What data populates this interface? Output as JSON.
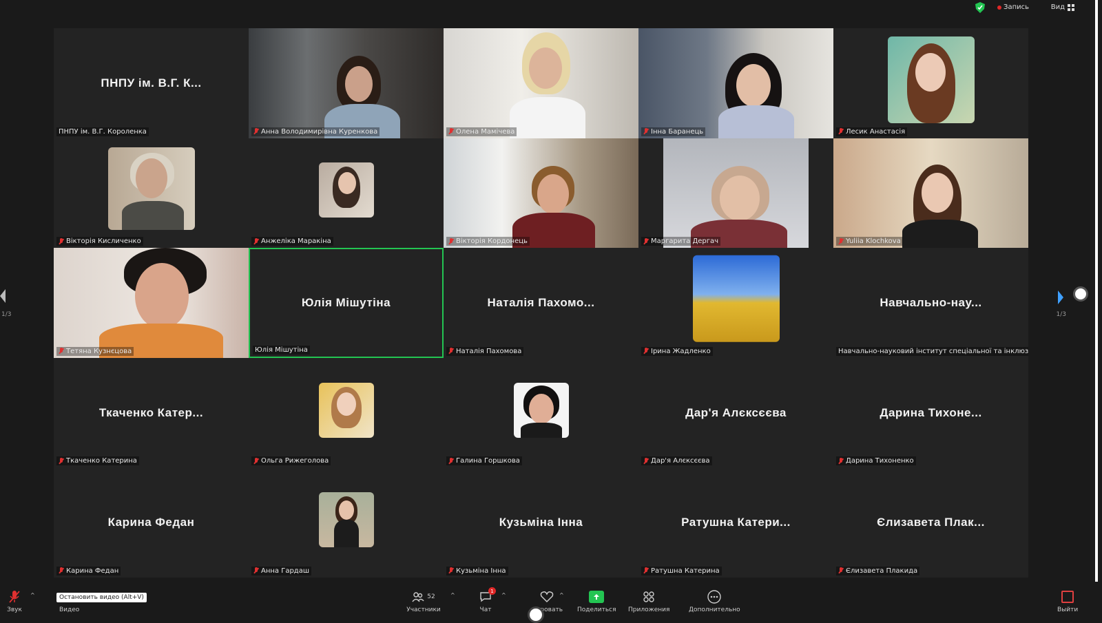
{
  "top": {
    "recording_label": "Запись",
    "view_label": "Вид"
  },
  "tiles": [
    {
      "big": "ПНПУ ім. В.Г. К...",
      "label": "ПНПУ ім. В.Г. Короленка",
      "muted": false
    },
    {
      "big": "",
      "label": "Анна Володимирівна Куренкова",
      "muted": true
    },
    {
      "big": "",
      "label": "Олена Мамічева",
      "muted": true
    },
    {
      "big": "",
      "label": "Інна Баранець",
      "muted": true
    },
    {
      "big": "",
      "label": "Лесик Анастасія",
      "muted": true
    },
    {
      "big": "",
      "label": "Вікторія Кисличенко",
      "muted": true
    },
    {
      "big": "",
      "label": "Анжеліка Маракіна",
      "muted": true
    },
    {
      "big": "",
      "label": "Вікторія Кордонець",
      "muted": true
    },
    {
      "big": "",
      "label": "Маргарита Дергач",
      "muted": true
    },
    {
      "big": "",
      "label": "Yuliia Klochkova",
      "muted": true
    },
    {
      "big": "",
      "label": "Тетяна Кузнєцова",
      "muted": true
    },
    {
      "big": "Юлія Мішутіна",
      "label": "Юлія Мішутіна",
      "muted": false
    },
    {
      "big": "Наталія Пахомо...",
      "label": "Наталія Пахомова",
      "muted": true
    },
    {
      "big": "",
      "label": "Ірина Жадленко",
      "muted": true
    },
    {
      "big": "Навчально-нау...",
      "label": "Навчально-науковий інститут спеціальної та інклюзи...",
      "muted": false
    },
    {
      "big": "Ткаченко Катер...",
      "label": "Ткаченко Катерина",
      "muted": true
    },
    {
      "big": "",
      "label": "Ольга Рижеголова",
      "muted": true
    },
    {
      "big": "",
      "label": "Галина Горшкова",
      "muted": true
    },
    {
      "big": "Дар'я Алєксєєва",
      "label": "Дар'я Алєксєєва",
      "muted": true
    },
    {
      "big": "Дарина Тихоне...",
      "label": "Дарина Тихоненко",
      "muted": true
    },
    {
      "big": "Карина Федан",
      "label": "Карина Федан",
      "muted": true
    },
    {
      "big": "",
      "label": "Анна Гардаш",
      "muted": true
    },
    {
      "big": "Кузьміна Інна",
      "label": "Кузьміна Інна",
      "muted": true
    },
    {
      "big": "Ратушна Катери...",
      "label": "Ратушна Катерина",
      "muted": true
    },
    {
      "big": "Єлизавета Плак...",
      "label": "Єлизавета Плакида",
      "muted": true
    }
  ],
  "pager": {
    "left": "1/3",
    "right": "1/3"
  },
  "toolbar": {
    "audio": "Звук",
    "video": "Видео",
    "video_tooltip": "Остановить видео (Alt+V)",
    "participants": "Участники",
    "participants_count": "52",
    "chat": "Чат",
    "chat_badge": "1",
    "react": "...ировать",
    "share": "Поделиться",
    "apps": "Приложения",
    "more": "Дополнительно",
    "exit": "Выйти"
  },
  "colors": {
    "active_speaker": "#23c552",
    "muted_mic": "#e03030",
    "share": "#23c552"
  }
}
